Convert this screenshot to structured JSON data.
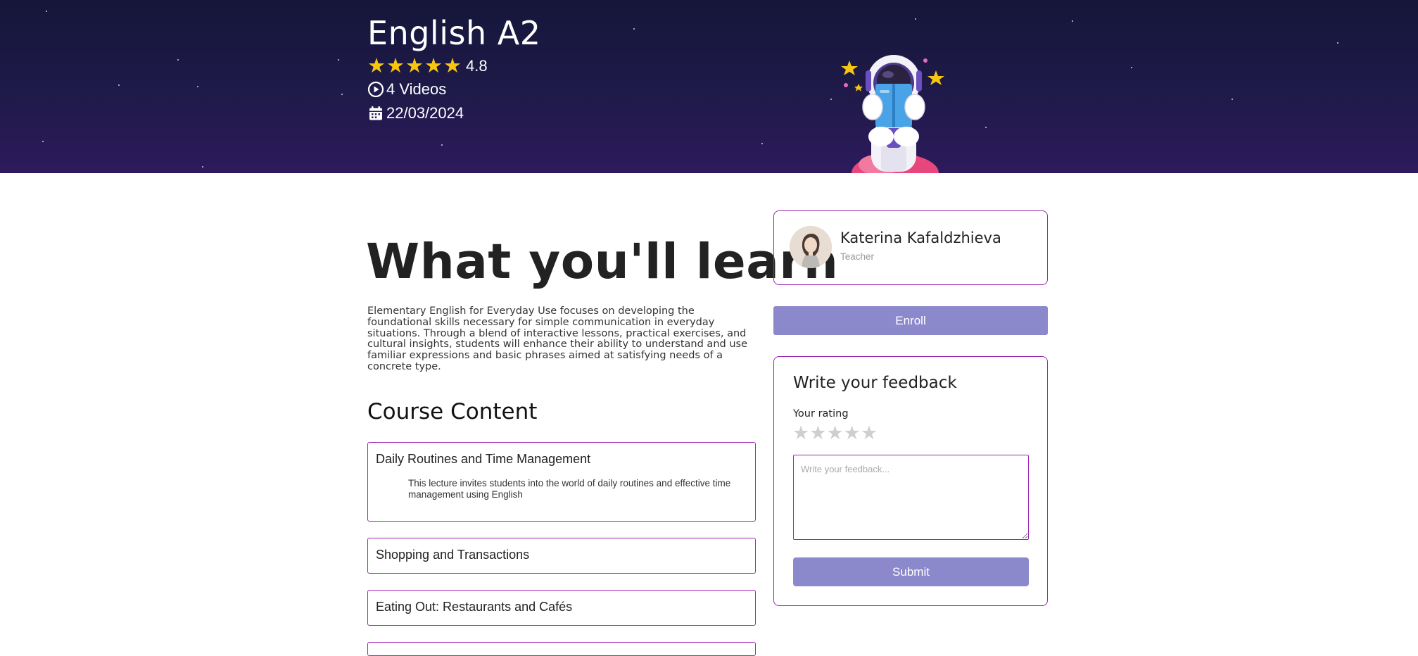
{
  "hero": {
    "title": "English A2",
    "rating": 4.8,
    "rating_text": "4.8",
    "stars_filled": 5,
    "videos_text": "4 Videos",
    "date_text": "22/03/2024",
    "colors": {
      "star": "#f7c613",
      "bg_top": "#15163a",
      "bg_bottom": "#2d1a5c"
    },
    "icons": [
      "star-icon",
      "play-circle-icon",
      "calendar-icon"
    ]
  },
  "main": {
    "learn_title": "What you'll learn",
    "description": "Elementary English for Everyday Use focuses on developing the foundational skills necessary for simple communication in everyday situations. Through a blend of interactive lessons, practical exercises, and cultural insights, students will enhance their ability to understand and use familiar expressions and basic phrases aimed at satisfying needs of a concrete type.",
    "content_title": "Course Content",
    "lessons": [
      {
        "title": "Daily Routines and Time Management",
        "description": "This lecture invites students into the world of daily routines and effective time management using English",
        "expanded": true
      },
      {
        "title": "Shopping and Transactions",
        "description": "",
        "expanded": false
      },
      {
        "title": "Eating Out: Restaurants and Cafés",
        "description": "",
        "expanded": false
      }
    ]
  },
  "teacher": {
    "name": "Katerina Kafaldzhieva",
    "role": "Teacher"
  },
  "enroll": {
    "label": "Enroll"
  },
  "feedback": {
    "title": "Write your feedback",
    "rating_label": "Your rating",
    "rating_value": 0,
    "max_rating": 5,
    "placeholder": "Write your feedback...",
    "value": "",
    "submit_label": "Submit"
  },
  "colors": {
    "accent_border": "#9c27b0",
    "button": "#8c88cc",
    "empty_star": "#cfcfcf"
  }
}
